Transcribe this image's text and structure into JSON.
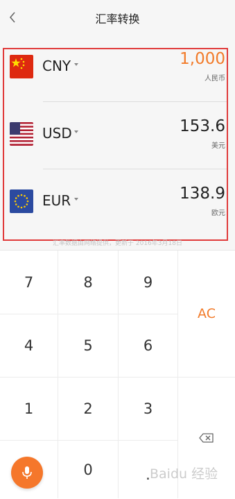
{
  "header": {
    "title": "汇率转换"
  },
  "currencies": [
    {
      "code": "CNY",
      "value": "1,000",
      "name": "人民币",
      "active": true
    },
    {
      "code": "USD",
      "value": "153.6",
      "name": "美元",
      "active": false
    },
    {
      "code": "EUR",
      "value": "138.9",
      "name": "欧元",
      "active": false
    }
  ],
  "note": "汇率数据由网络提供，更新于 2016年3月18日",
  "keypad": {
    "k7": "7",
    "k8": "8",
    "k9": "9",
    "k4": "4",
    "k5": "5",
    "k6": "6",
    "k1": "1",
    "k2": "2",
    "k3": "3",
    "k0": "0",
    "dot": ".",
    "clear": "AC"
  },
  "watermark": "Baidu 经验",
  "colors": {
    "accent": "#f27b2a",
    "highlight_frame": "#e03a3a",
    "mic": "#f5772b"
  },
  "icons": {
    "back": "chevron-left-icon",
    "backspace": "backspace-icon",
    "mic": "microphone-icon"
  }
}
